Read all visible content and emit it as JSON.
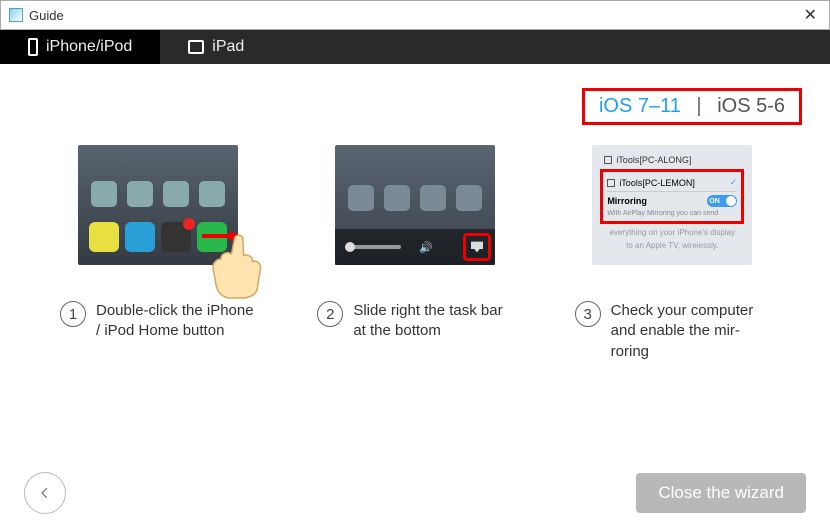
{
  "window": {
    "title": "Guide"
  },
  "tabs": {
    "iphone_ipod": "iPhone/iPod",
    "ipad": "iPad"
  },
  "versions": {
    "active": "iOS 7–11",
    "separator": "|",
    "inactive": "iOS 5-6"
  },
  "steps": {
    "s1": {
      "num": "1",
      "text": "Double-click the iPhone / iPod Home button"
    },
    "s2": {
      "num": "2",
      "text": "Slide right the task bar at the bottom"
    },
    "s3": {
      "num": "3",
      "text": "Check your computer and enable the mir­roring"
    }
  },
  "shot3": {
    "item1": "iTools[PC-ALONG]",
    "item2": "iTools[PC-LEMON]",
    "mirroring": "Mirroring",
    "toggle": "ON",
    "hint": "With AirPlay Mirroring you can send",
    "below1": "everything on your iPhone's display",
    "below2": "to an Apple TV, wirelessly."
  },
  "footer": {
    "close": "Close the wizard"
  }
}
